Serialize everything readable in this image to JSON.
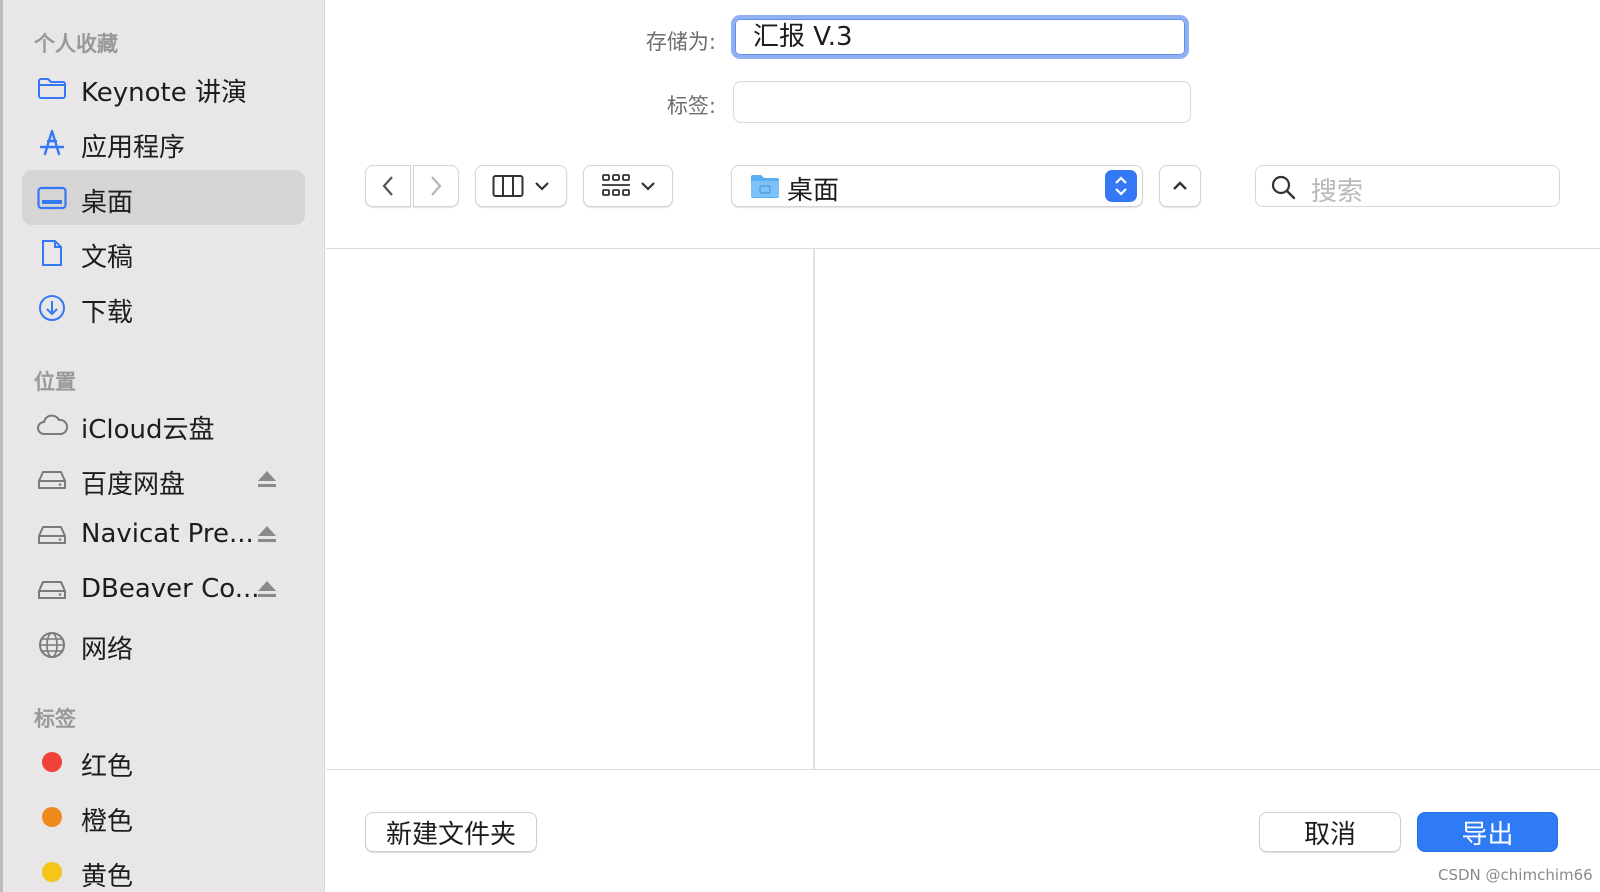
{
  "sidebar": {
    "favorites_title": "个人收藏",
    "favorites": [
      {
        "label": "Keynote 讲演",
        "icon": "folder-icon"
      },
      {
        "label": "应用程序",
        "icon": "applications-icon"
      },
      {
        "label": "桌面",
        "icon": "desktop-icon",
        "selected": true
      },
      {
        "label": "文稿",
        "icon": "document-icon"
      },
      {
        "label": "下载",
        "icon": "download-icon"
      }
    ],
    "locations_title": "位置",
    "locations": [
      {
        "label": "iCloud云盘",
        "icon": "cloud-icon"
      },
      {
        "label": "百度网盘",
        "icon": "drive-icon",
        "eject": true
      },
      {
        "label": "Navicat Pre...",
        "icon": "drive-icon",
        "eject": true
      },
      {
        "label": "DBeaver Co...",
        "icon": "drive-icon",
        "eject": true
      },
      {
        "label": "网络",
        "icon": "network-icon"
      }
    ],
    "tags_title": "标签",
    "tags": [
      {
        "label": "红色",
        "color": "#f0413a"
      },
      {
        "label": "橙色",
        "color": "#f18a1c"
      },
      {
        "label": "黄色",
        "color": "#f5c518"
      }
    ]
  },
  "form": {
    "save_as_label": "存储为:",
    "save_as_value": "汇报 V.3",
    "tags_label": "标签:",
    "tags_value": ""
  },
  "toolbar": {
    "location_label": "桌面",
    "search_placeholder": "搜索"
  },
  "footer": {
    "new_folder": "新建文件夹",
    "cancel": "取消",
    "export": "导出"
  },
  "watermark": "CSDN @chimchim66",
  "colors": {
    "accent": "#2f7bf5",
    "sidebar_icon": "#3478f6"
  }
}
